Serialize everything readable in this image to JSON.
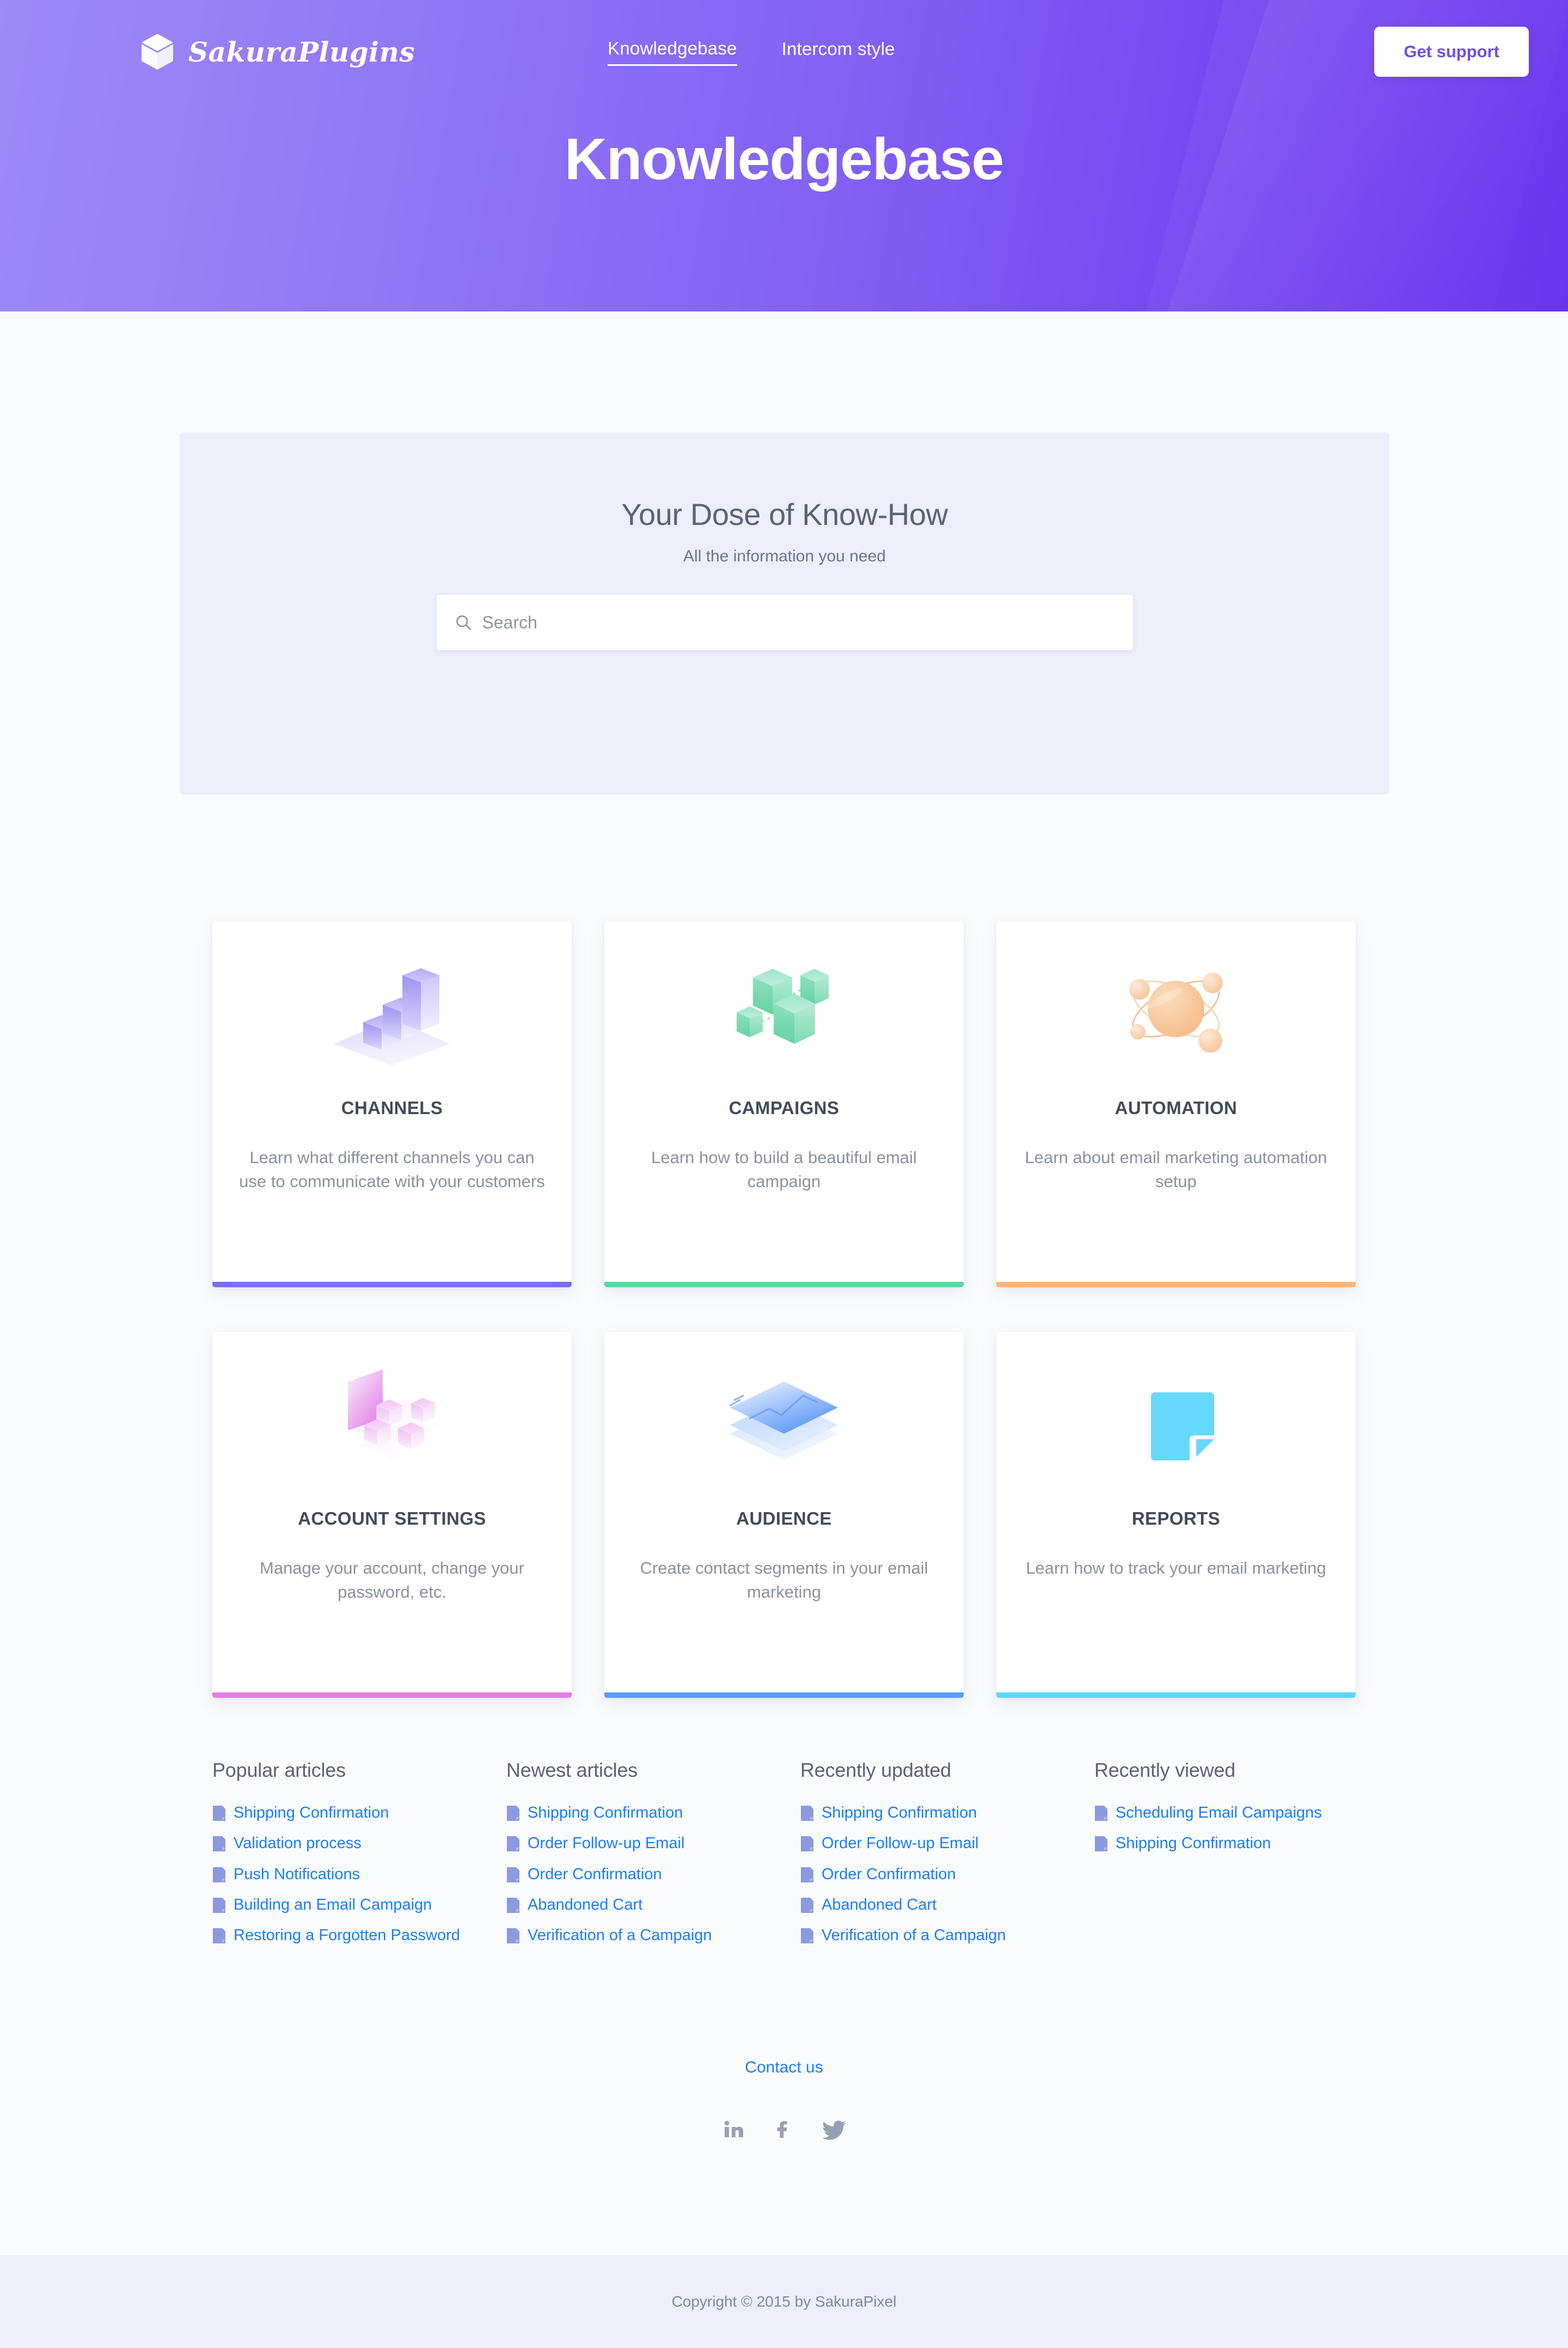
{
  "header": {
    "brand_name": "SakuraPlugins",
    "brand_icon": "box-3d-icon",
    "nav": [
      {
        "label": "Knowledgebase",
        "active": true
      },
      {
        "label": "Intercom style",
        "active": false
      }
    ],
    "cta_label": "Get support",
    "page_title": "Knowledgebase",
    "gradient_from": "#9d8bf7",
    "gradient_to": "#6a35ef"
  },
  "search_panel": {
    "heading": "Your Dose of Know-How",
    "subheading": "All the information you need",
    "search_placeholder": "Search",
    "search_value": "",
    "search_icon": "search-icon",
    "background": "#eceef9"
  },
  "categories": [
    {
      "title": "CHANNELS",
      "description": "Learn what different channels you can use to communicate with your customers",
      "icon": "bar-chart-3d-icon",
      "accent": "#7b6ef0"
    },
    {
      "title": "CAMPAIGNS",
      "description": "Learn how to build a beautiful email campaign",
      "icon": "cubes-network-icon",
      "accent": "#62d3a4"
    },
    {
      "title": "AUTOMATION",
      "description": "Learn about email marketing automation setup",
      "icon": "atom-orbit-icon",
      "accent": "#f5b87c"
    },
    {
      "title": "ACCOUNT SETTINGS",
      "description": "Manage your account, change your password, etc.",
      "icon": "wall-blocks-icon",
      "accent": "#e87ee0"
    },
    {
      "title": "AUDIENCE",
      "description": "Create contact segments in your email marketing",
      "icon": "layered-planes-icon",
      "accent": "#5b9bf5"
    },
    {
      "title": "REPORTS",
      "description": "Learn how to track your email marketing",
      "icon": "note-page-icon",
      "accent": "#5bd8f5"
    }
  ],
  "article_columns": [
    {
      "title": "Popular articles",
      "items": [
        "Shipping Confirmation",
        "Validation process",
        "Push Notifications",
        "Building an Email Campaign",
        "Restoring a Forgotten Password"
      ]
    },
    {
      "title": "Newest articles",
      "items": [
        "Shipping Confirmation",
        "Order Follow-up Email",
        "Order Confirmation",
        "Abandoned Cart",
        "Verification of a Campaign"
      ]
    },
    {
      "title": "Recently updated",
      "items": [
        "Shipping Confirmation",
        "Order Follow-up Email",
        "Order Confirmation",
        "Abandoned Cart",
        "Verification of a Campaign"
      ]
    },
    {
      "title": "Recently viewed",
      "items": [
        "Scheduling Email Campaigns",
        "Shipping Confirmation"
      ]
    }
  ],
  "footer": {
    "contact_label": "Contact us",
    "social": [
      {
        "name": "linkedin-icon"
      },
      {
        "name": "facebook-icon"
      },
      {
        "name": "twitter-icon"
      }
    ],
    "copyright": "Copyright © 2015 by SakuraPixel"
  }
}
